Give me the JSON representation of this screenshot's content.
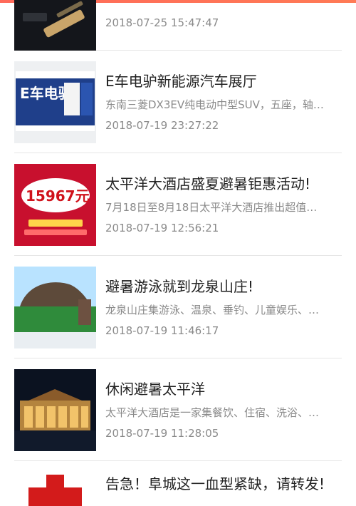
{
  "articles": [
    {
      "title": "",
      "summary": "",
      "date": "2018-07-25 15:47:47",
      "image": "phone-product-photo"
    },
    {
      "title": "E车电驴新能源汽车展厅",
      "summary": "东南三菱DX3EV纯电动中型SUV，五座，轴…",
      "date": "2018-07-19 23:27:22",
      "image": "ev-showroom-sign"
    },
    {
      "title": "太平洋大酒店盛夏避暑钜惠活动!",
      "summary": "7月18日至8月18日太平洋大酒店推出超值…",
      "date": "2018-07-19 12:56:21",
      "image": "hotel-promo-card",
      "image_text": "15967元"
    },
    {
      "title": "避暑游泳就到龙泉山庄!",
      "summary": "龙泉山庄集游泳、温泉、垂钓、儿童娱乐、…",
      "date": "2018-07-19 11:46:17",
      "image": "resort-gate-photo"
    },
    {
      "title": "休闲避暑太平洋",
      "summary": "太平洋大酒店是一家集餐饮、住宿、洗浴、…",
      "date": "2018-07-19 11:28:05",
      "image": "hotel-night-photo"
    },
    {
      "title": "告急！阜城这一血型紧缺，请转发!",
      "summary": "",
      "date": "",
      "image": "red-cross-icon"
    }
  ]
}
